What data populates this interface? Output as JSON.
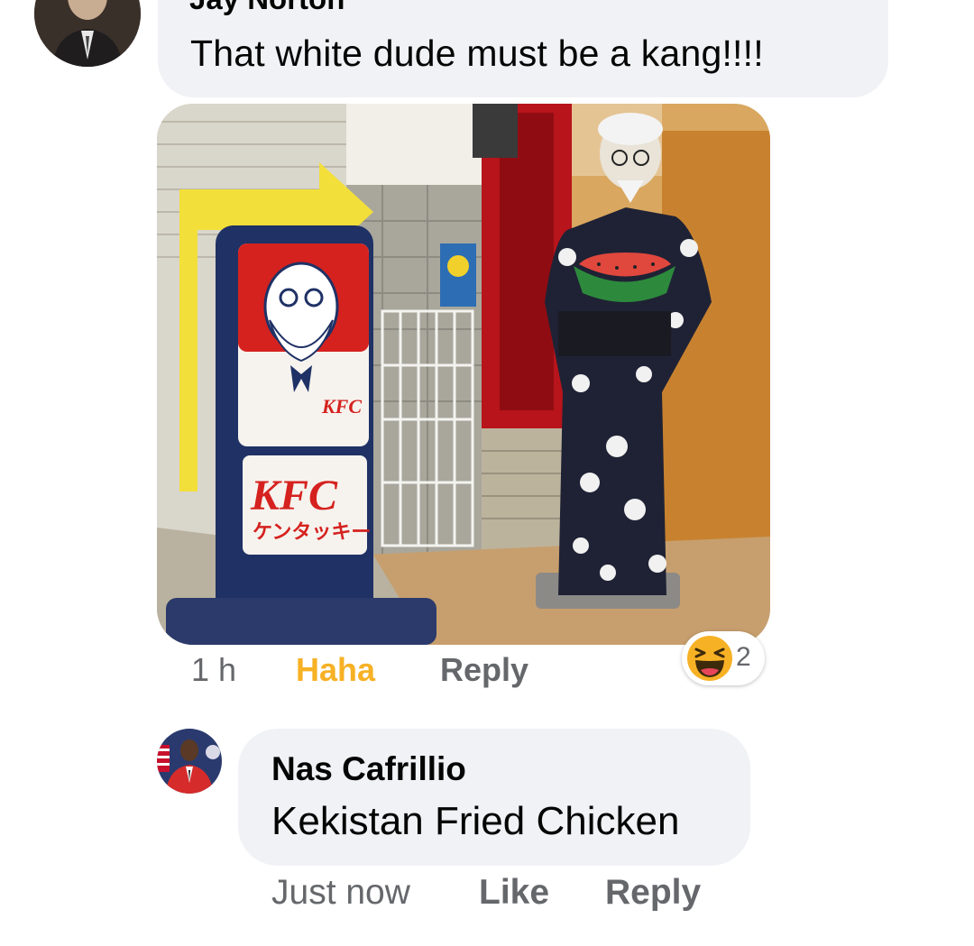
{
  "comment_top": {
    "author": "Jay Norton",
    "text": "That white dude must be a kang!!!!",
    "timestamp": "1 h",
    "reaction_label": "Haha",
    "reply_label": "Reply",
    "reaction_count": "2",
    "reaction_icon": "haha-emoji-icon"
  },
  "photo": {
    "sign_top_text": "KFC",
    "sign_logo": "KFC",
    "sign_katakana": "ケンタッキー"
  },
  "comment_second": {
    "author": "Nas Cafrillio",
    "text": "Kekistan Fried Chicken",
    "timestamp": "Just now",
    "like_label": "Like",
    "reply_label": "Reply"
  },
  "colors": {
    "bubble": "#f0f2f5",
    "meta_text": "#65676b",
    "haha": "#f7b125",
    "kfc_red": "#d5221f"
  }
}
